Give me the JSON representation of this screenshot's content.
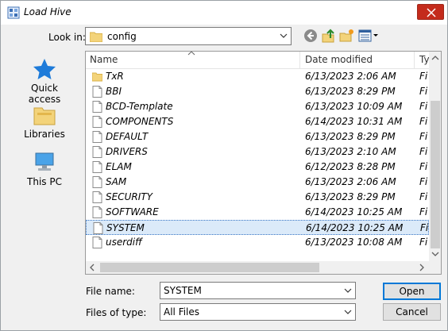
{
  "window": {
    "title": "Load Hive"
  },
  "lookin": {
    "label": "Look in:",
    "value": "config"
  },
  "places": [
    {
      "label": "Quick access",
      "icon": "star-icon"
    },
    {
      "label": "Libraries",
      "icon": "libraries-icon"
    },
    {
      "label": "This PC",
      "icon": "computer-icon"
    }
  ],
  "columns": {
    "name": "Name",
    "date": "Date modified",
    "type": "Ty"
  },
  "files": [
    {
      "name": "TxR",
      "date": "6/13/2023 2:06 AM",
      "type": "Fi",
      "kind": "folder"
    },
    {
      "name": "BBI",
      "date": "6/13/2023 8:29 PM",
      "type": "Fi",
      "kind": "file"
    },
    {
      "name": "BCD-Template",
      "date": "6/13/2023 10:09 AM",
      "type": "Fi",
      "kind": "file"
    },
    {
      "name": "COMPONENTS",
      "date": "6/14/2023 10:31 AM",
      "type": "Fi",
      "kind": "file"
    },
    {
      "name": "DEFAULT",
      "date": "6/13/2023 8:29 PM",
      "type": "Fi",
      "kind": "file"
    },
    {
      "name": "DRIVERS",
      "date": "6/13/2023 2:10 AM",
      "type": "Fi",
      "kind": "file"
    },
    {
      "name": "ELAM",
      "date": "6/12/2023 8:28 PM",
      "type": "Fi",
      "kind": "file"
    },
    {
      "name": "SAM",
      "date": "6/13/2023 2:06 AM",
      "type": "Fi",
      "kind": "file"
    },
    {
      "name": "SECURITY",
      "date": "6/13/2023 8:29 PM",
      "type": "Fi",
      "kind": "file"
    },
    {
      "name": "SOFTWARE",
      "date": "6/14/2023 10:25 AM",
      "type": "Fi",
      "kind": "file"
    },
    {
      "name": "SYSTEM",
      "date": "6/14/2023 10:25 AM",
      "type": "Fi",
      "kind": "file",
      "selected": true
    },
    {
      "name": "userdiff",
      "date": "6/13/2023 10:08 AM",
      "type": "Fi",
      "kind": "file"
    }
  ],
  "filename": {
    "label": "File name:",
    "value": "SYSTEM"
  },
  "filetype": {
    "label": "Files of type:",
    "value": "All Files"
  },
  "buttons": {
    "open": "Open",
    "cancel": "Cancel"
  }
}
